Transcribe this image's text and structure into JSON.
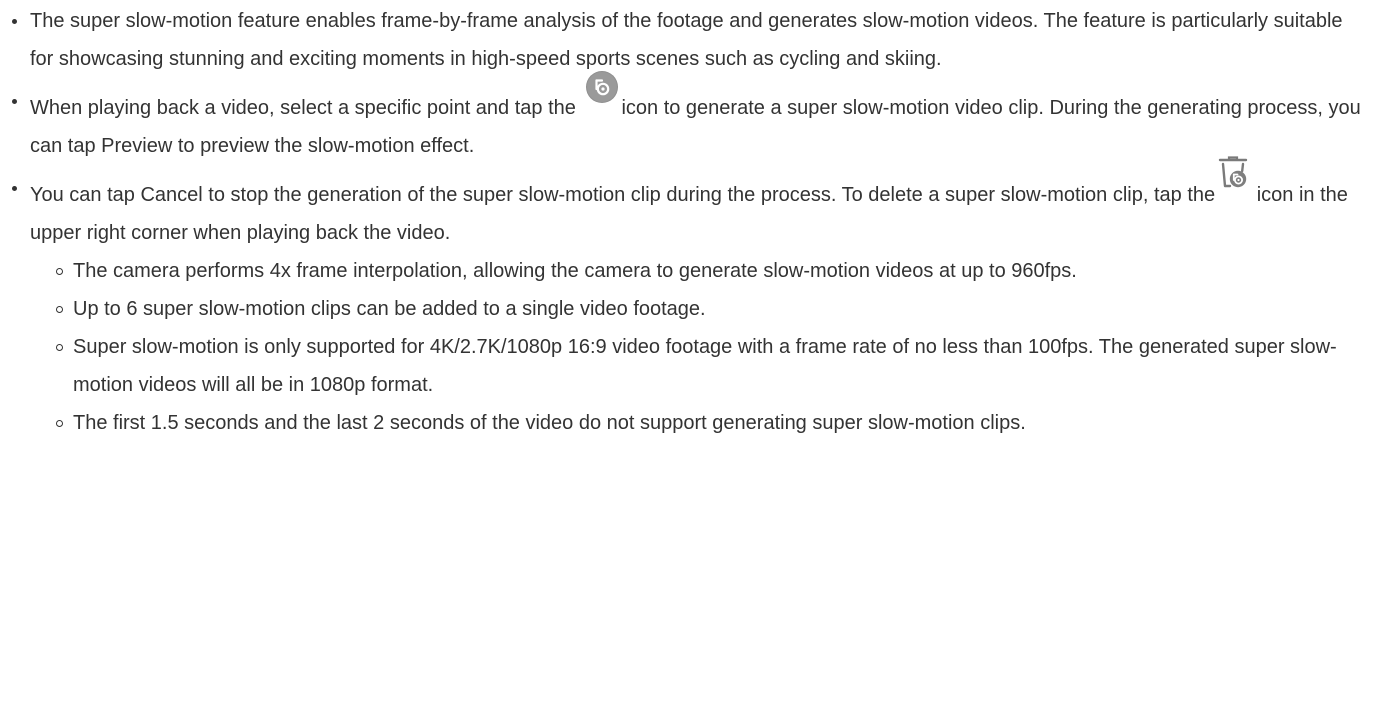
{
  "bullets": [
    {
      "text": "The super slow-motion feature enables frame-by-frame analysis of the footage and generates slow-motion videos. The feature is particularly suitable for showcasing stunning and exciting moments in high-speed sports scenes such as cycling and skiing."
    },
    {
      "text_before_icon": "When playing back a video, select a specific point and tap the ",
      "icon": "super-slow-motion-icon",
      "text_after_icon": "icon to generate a super slow-motion video clip. During the generating process, you can tap Preview to preview the slow-motion effect."
    },
    {
      "text_before_icon": "You can tap Cancel to stop the generation of the super slow-motion clip during the process. To delete a super slow-motion clip, tap the",
      "icon": "delete-slow-motion-icon",
      "text_after_icon": " icon in the upper right corner when playing back the video.",
      "sub_items": [
        "The camera performs 4x frame interpolation, allowing the camera to generate slow-motion videos at up to 960fps.",
        "Up to 6 super slow-motion clips can be added to a single video footage.",
        "Super slow-motion is only supported for 4K/2.7K/1080p 16:9 video footage with a frame rate of no less than 100fps. The generated super slow-motion videos will all be in 1080p format.",
        "The first 1.5 seconds and the last 2 seconds of the video do not support generating super slow-motion clips."
      ]
    }
  ],
  "colors": {
    "text": "#333333",
    "icon_gray": "#9a9a9a",
    "icon_dark": "#7a7a7a"
  }
}
